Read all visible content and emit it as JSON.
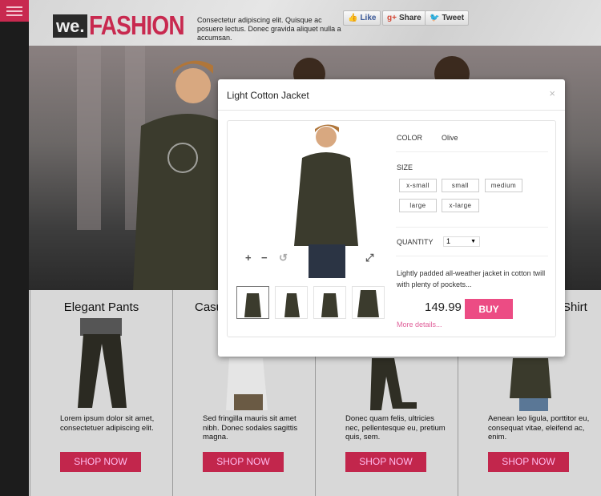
{
  "header": {
    "logo_we": "we.",
    "logo_fashion": "FASHION",
    "tagline": "Consectetur adipiscing elit. Quisque ac posuere lectus. Donec gravida aliquet nulla a accumsan.",
    "like": "Like",
    "share": "Share",
    "tweet": "Tweet"
  },
  "products": [
    {
      "title": "Elegant Pants",
      "desc": "Lorem ipsum dolor sit amet, consectetuer adipiscing elit.",
      "button": "SHOP NOW"
    },
    {
      "title": "Casu",
      "desc": "Sed fringilla mauris sit amet nibh. Donec sodales sagittis magna.",
      "button": "SHOP NOW"
    },
    {
      "title": "",
      "desc": "Donec quam felis, ultricies nec, pellentesque eu, pretium quis, sem.",
      "button": "SHOP NOW"
    },
    {
      "title": "Shirt",
      "desc": "Aenean leo ligula, porttitor eu, consequat vitae, eleifend ac, enim.",
      "button": "SHOP NOW"
    }
  ],
  "modal": {
    "title": "Light Cotton Jacket",
    "close": "×",
    "color_label": "COLOR",
    "color_value": "Olive",
    "size_label": "SIZE",
    "sizes": [
      "x-small",
      "small",
      "medium",
      "large",
      "x-large"
    ],
    "quantity_label": "QUANTITY",
    "quantity_value": "1",
    "description": "Lightly padded all-weather jacket in cotton twill with plenty of pockets...",
    "price": "149.99",
    "buy": "BUY",
    "more": "More details...",
    "zoom_in": "+",
    "zoom_out": "−",
    "rotate": "↺",
    "expand": "⤢"
  },
  "colors": {
    "accent": "#c8294f",
    "buy": "#ec4c84",
    "link": "#e0609a"
  }
}
